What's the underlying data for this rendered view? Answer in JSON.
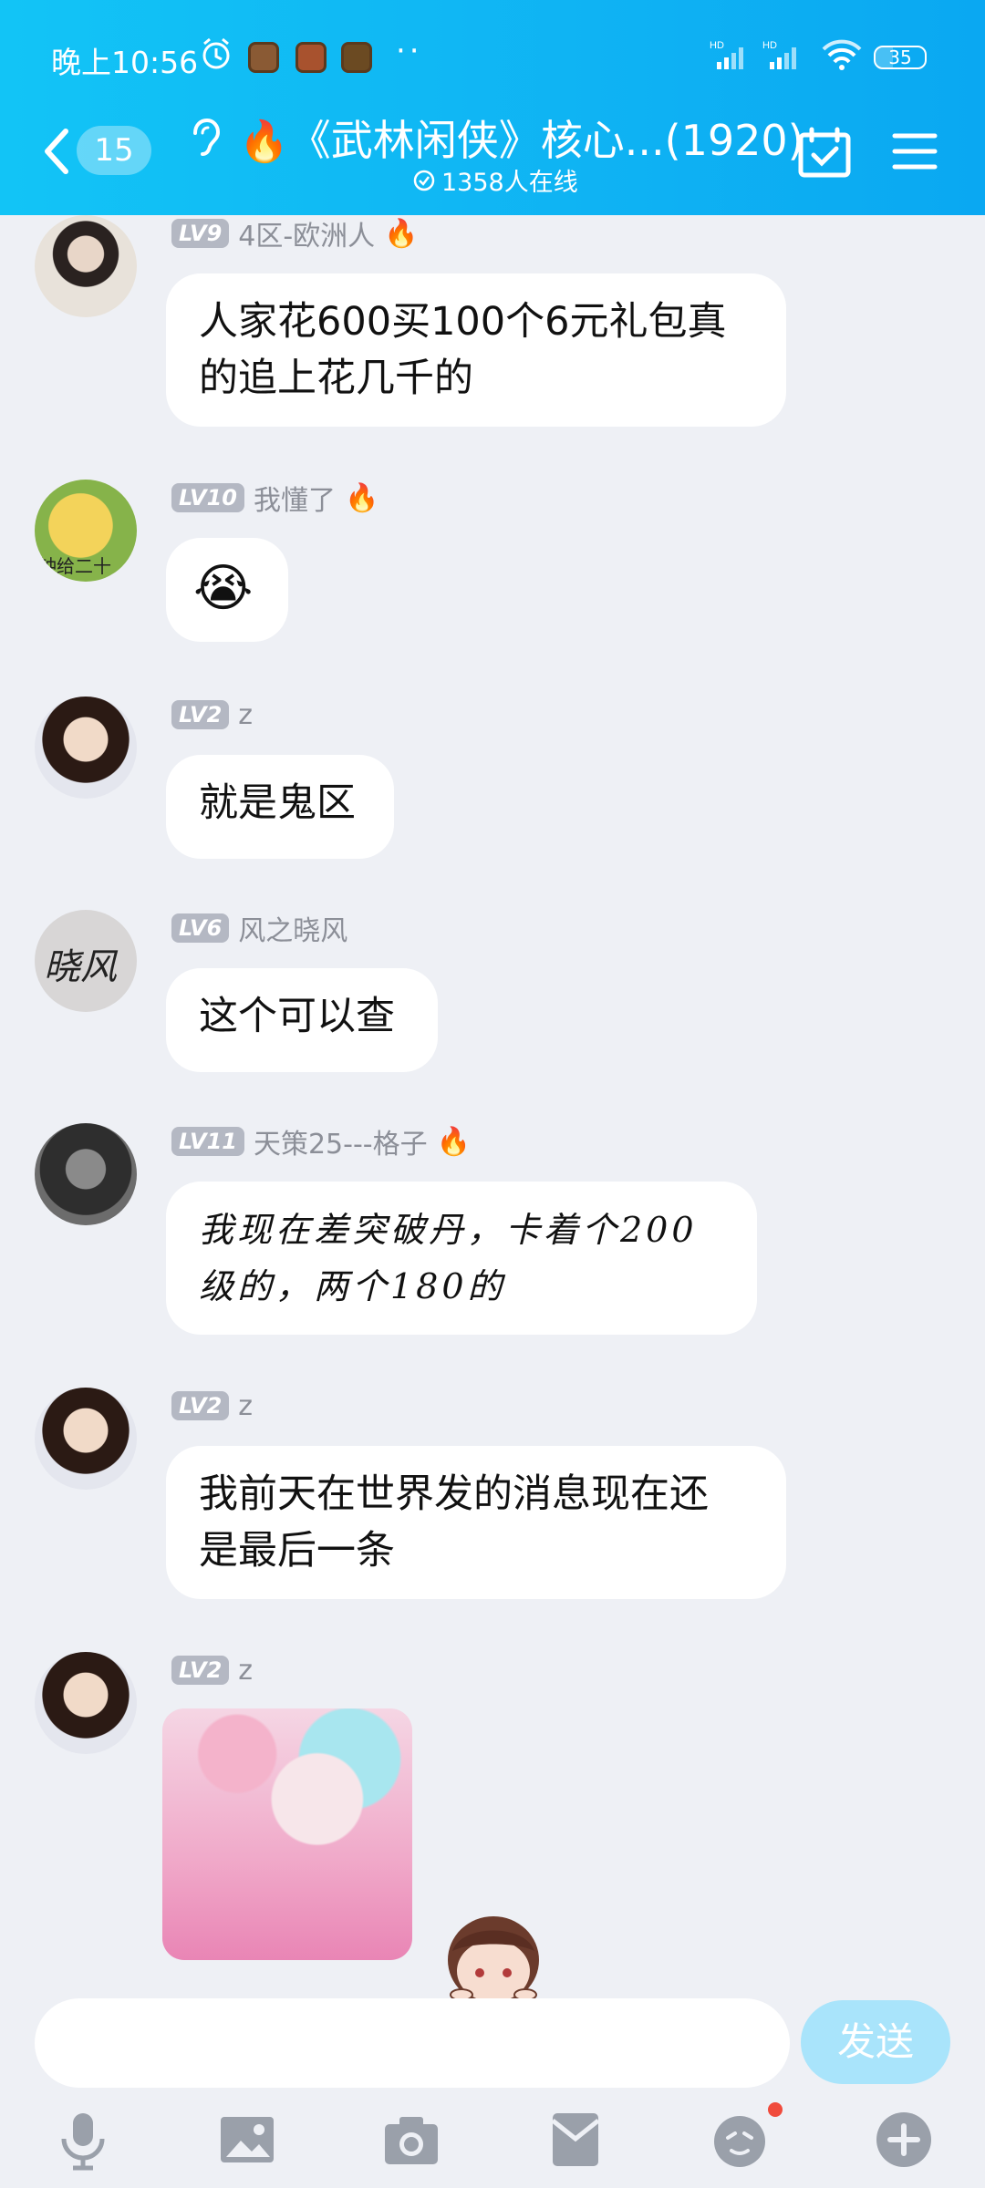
{
  "status_bar": {
    "time": "晚上10:56",
    "dots": "··",
    "battery": "35",
    "network_label": "HD",
    "wifi_label": "6"
  },
  "header": {
    "unread_count": "15",
    "title_fire": "🔥",
    "title": "《武林闲侠》核心...(1920)",
    "online": "1358人在线"
  },
  "messages": [
    {
      "level": "LV9",
      "name": "4区-欧洲人",
      "fire": "🔥",
      "text": "人家花600买100个6元礼包真的追上花几千的",
      "line1": "人家花600买100个6元礼包真",
      "line2": "的追上花几千的"
    },
    {
      "level": "LV10",
      "name": "我懂了",
      "fire": "🔥",
      "avatar_text": "钟给二十",
      "emoji": "😭"
    },
    {
      "level": "LV2",
      "name": "z",
      "text": "就是鬼区"
    },
    {
      "level": "LV6",
      "name": "风之晓风",
      "avatar_text": "晓风",
      "text": "这个可以查"
    },
    {
      "level": "LV11",
      "name": "天策25---格子",
      "fire": "🔥",
      "line1": "我现在差突破丹，卡着个200",
      "line2": "级的，两个180的"
    },
    {
      "level": "LV2",
      "name": "z",
      "line1": "我前天在世界发的消息现在还",
      "line2": "是最后一条"
    },
    {
      "level": "LV2",
      "name": "z",
      "image": "sticker-image"
    }
  ],
  "input": {
    "placeholder": "",
    "send_label": "发送"
  },
  "toolbar": [
    "microphone-icon",
    "image-icon",
    "camera-icon",
    "red-packet-icon",
    "emoji-icon",
    "plus-icon"
  ],
  "colors": {
    "header": "#12c4f6",
    "send": "#a9e4fb",
    "bg": "#eef0f5"
  }
}
